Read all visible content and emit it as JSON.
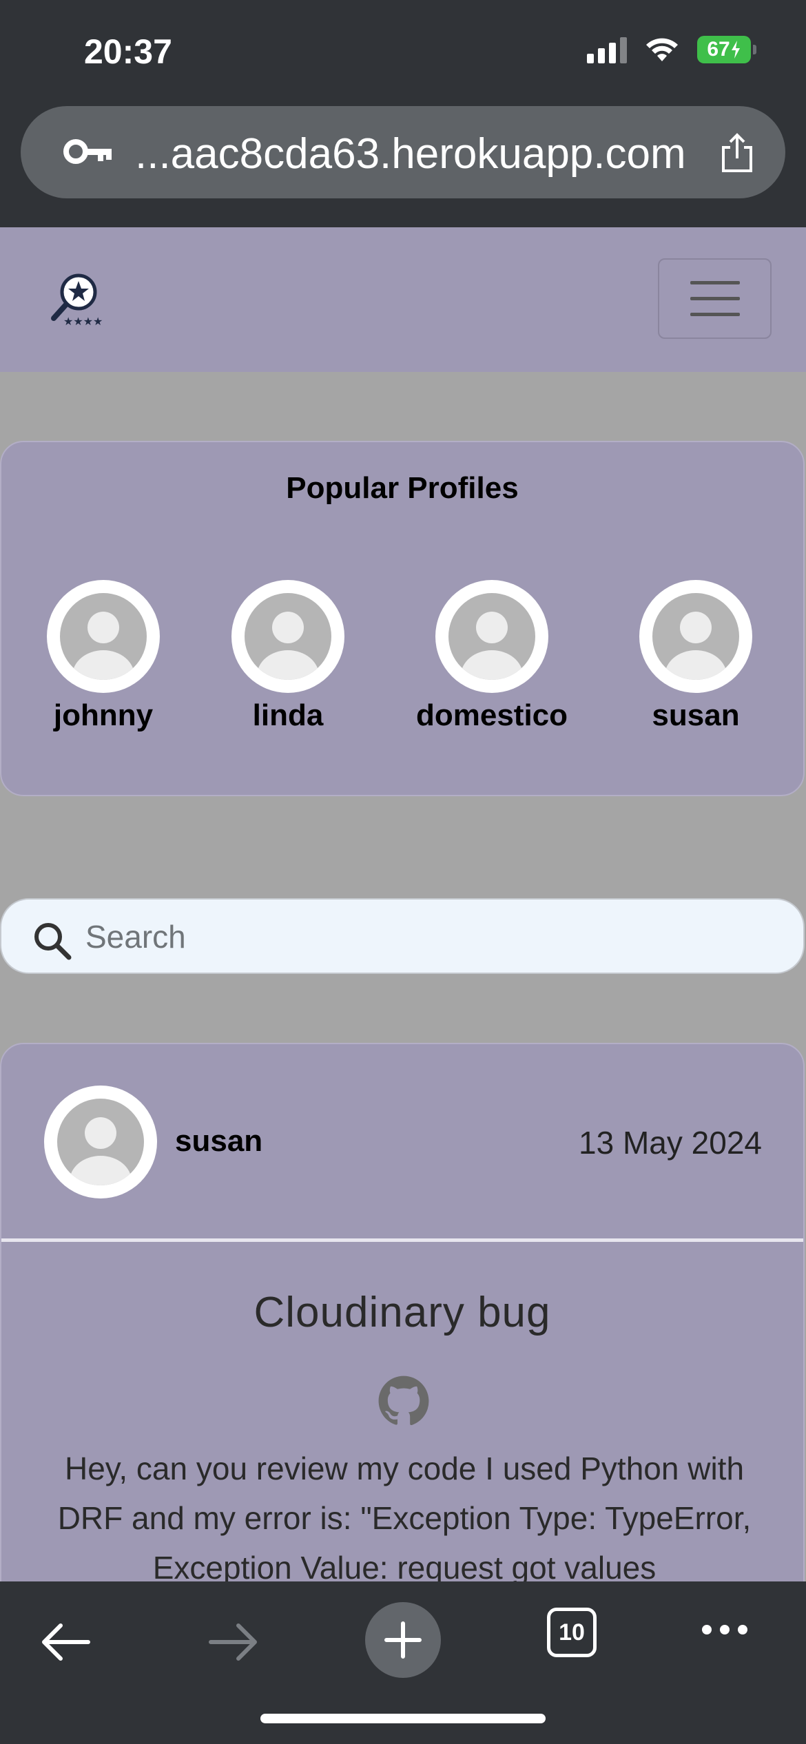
{
  "status_bar": {
    "time": "20:37",
    "battery": "67"
  },
  "browser": {
    "url": "...aac8cda63.herokuapp.com",
    "tab_count": "10"
  },
  "popular_profiles": {
    "title": "Popular Profiles",
    "profiles": [
      {
        "name": "johnny"
      },
      {
        "name": "linda"
      },
      {
        "name": "domestico"
      },
      {
        "name": "susan"
      }
    ]
  },
  "search": {
    "placeholder": "Search"
  },
  "post": {
    "author": "susan",
    "date": "13 May 2024",
    "title": "Cloudinary bug",
    "body": "Hey, can you review my code I used Python with DRF and my error is: \"Exception Type: TypeError, Exception Value: request got values"
  },
  "colors": {
    "nav_bg": "#9e99b4",
    "page_bg": "#a5a5a5",
    "browser_chrome": "#303337",
    "search_bg": "#eef5fc"
  }
}
